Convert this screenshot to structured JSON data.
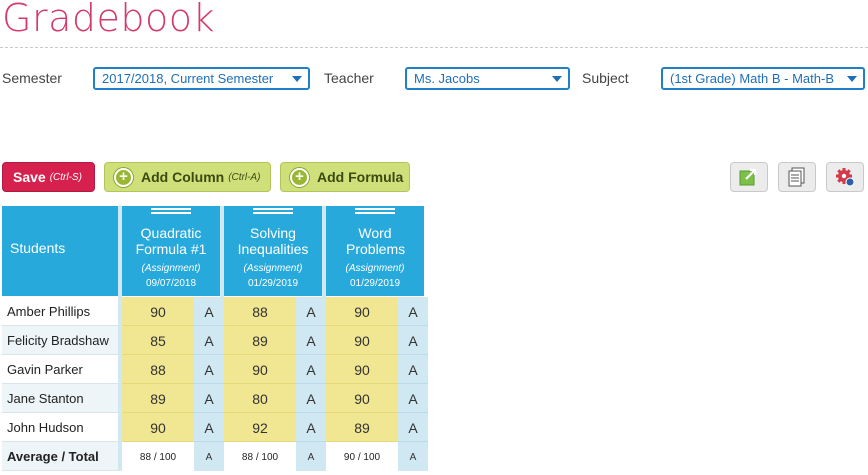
{
  "page": {
    "title": "Gradebook"
  },
  "filters": {
    "semester_label": "Semester",
    "semester_value": "2017/2018, Current Semester",
    "teacher_label": "Teacher",
    "teacher_value": "Ms. Jacobs",
    "subject_label": "Subject",
    "subject_value": "(1st Grade) Math B - Math-B"
  },
  "toolbar": {
    "save_label": "Save",
    "save_shortcut": "(Ctrl-S)",
    "add_column_label": "Add Column",
    "add_column_shortcut": "(Ctrl-A)",
    "add_formula_label": "Add Formula",
    "export_icon": "export-icon",
    "report_icon": "report-icon",
    "settings_icon": "gear-icon"
  },
  "colors": {
    "accent": "#d43a6a",
    "header": "#27a9dc",
    "score": "#f1e691",
    "grade": "#cfe8f2",
    "save": "#d6214f",
    "green": "#cfe07a"
  },
  "table": {
    "students_header": "Students",
    "columns": [
      {
        "name": "Quadratic Formula #1",
        "kind": "(Assignment)",
        "date": "09/07/2018"
      },
      {
        "name": "Solving Inequalities",
        "kind": "(Assignment)",
        "date": "01/29/2019"
      },
      {
        "name": "Word Problems",
        "kind": "(Assignment)",
        "date": "01/29/2019"
      }
    ],
    "rows": [
      {
        "student": "Amber Phillips",
        "scores": [
          {
            "score": "90",
            "grade": "A"
          },
          {
            "score": "88",
            "grade": "A"
          },
          {
            "score": "90",
            "grade": "A"
          }
        ]
      },
      {
        "student": "Felicity Bradshaw",
        "scores": [
          {
            "score": "85",
            "grade": "A"
          },
          {
            "score": "89",
            "grade": "A"
          },
          {
            "score": "90",
            "grade": "A"
          }
        ]
      },
      {
        "student": "Gavin Parker",
        "scores": [
          {
            "score": "88",
            "grade": "A"
          },
          {
            "score": "90",
            "grade": "A"
          },
          {
            "score": "90",
            "grade": "A"
          }
        ]
      },
      {
        "student": "Jane Stanton",
        "scores": [
          {
            "score": "89",
            "grade": "A"
          },
          {
            "score": "80",
            "grade": "A"
          },
          {
            "score": "90",
            "grade": "A"
          }
        ]
      },
      {
        "student": "John Hudson",
        "scores": [
          {
            "score": "90",
            "grade": "A"
          },
          {
            "score": "92",
            "grade": "A"
          },
          {
            "score": "89",
            "grade": "A"
          }
        ]
      }
    ],
    "total_label": "Average / Total",
    "totals": [
      {
        "score": "88 / 100",
        "grade": "A"
      },
      {
        "score": "88 / 100",
        "grade": "A"
      },
      {
        "score": "90 / 100",
        "grade": "A"
      }
    ]
  }
}
